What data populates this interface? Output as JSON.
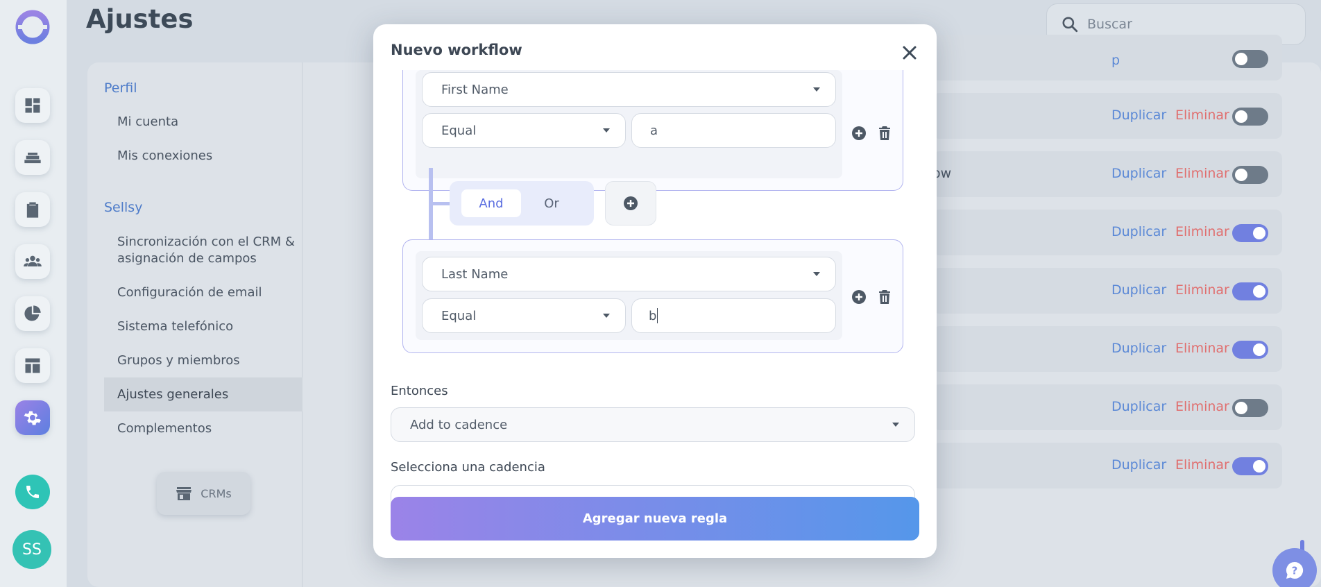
{
  "page": {
    "title": "Ajustes"
  },
  "search": {
    "placeholder": "Buscar"
  },
  "rail": {
    "avatar_initials": "SS"
  },
  "settings_nav": {
    "sections": [
      {
        "heading": "Perfil",
        "items": [
          "Mi cuenta",
          "Mis conexiones"
        ]
      },
      {
        "heading": "Sellsy",
        "items": [
          "Sincronización con el CRM & asignación de campos",
          "Configuración de email",
          "Sistema telefónico",
          "Grupos y miembros",
          "Ajustes generales",
          "Complementos"
        ]
      }
    ],
    "active_item": "Ajustes generales",
    "crms_button": "CRMs"
  },
  "workflow_rows": {
    "duplicate_label": "Duplicar",
    "delete_label": "Eliminar",
    "row_text_fragment": "ow",
    "toggles": [
      false,
      false,
      true,
      true,
      true,
      false,
      true
    ],
    "partial_top_link": "p"
  },
  "modal": {
    "title": "Nuevo workflow",
    "condition1": {
      "field": "First Name",
      "operator": "Equal",
      "value": "a"
    },
    "logic": {
      "and_label": "And",
      "or_label": "Or"
    },
    "condition2": {
      "field": "Last Name",
      "operator": "Equal",
      "value": "b"
    },
    "then_label": "Entonces",
    "then_action": "Add to cadence",
    "cadence_label": "Selecciona una cadencia",
    "submit_label": "Agregar nueva regla"
  },
  "colors": {
    "accent": "#7180e0",
    "delete": "#e06f6f",
    "link": "#5a88d6",
    "teal": "#2ec4b6"
  }
}
